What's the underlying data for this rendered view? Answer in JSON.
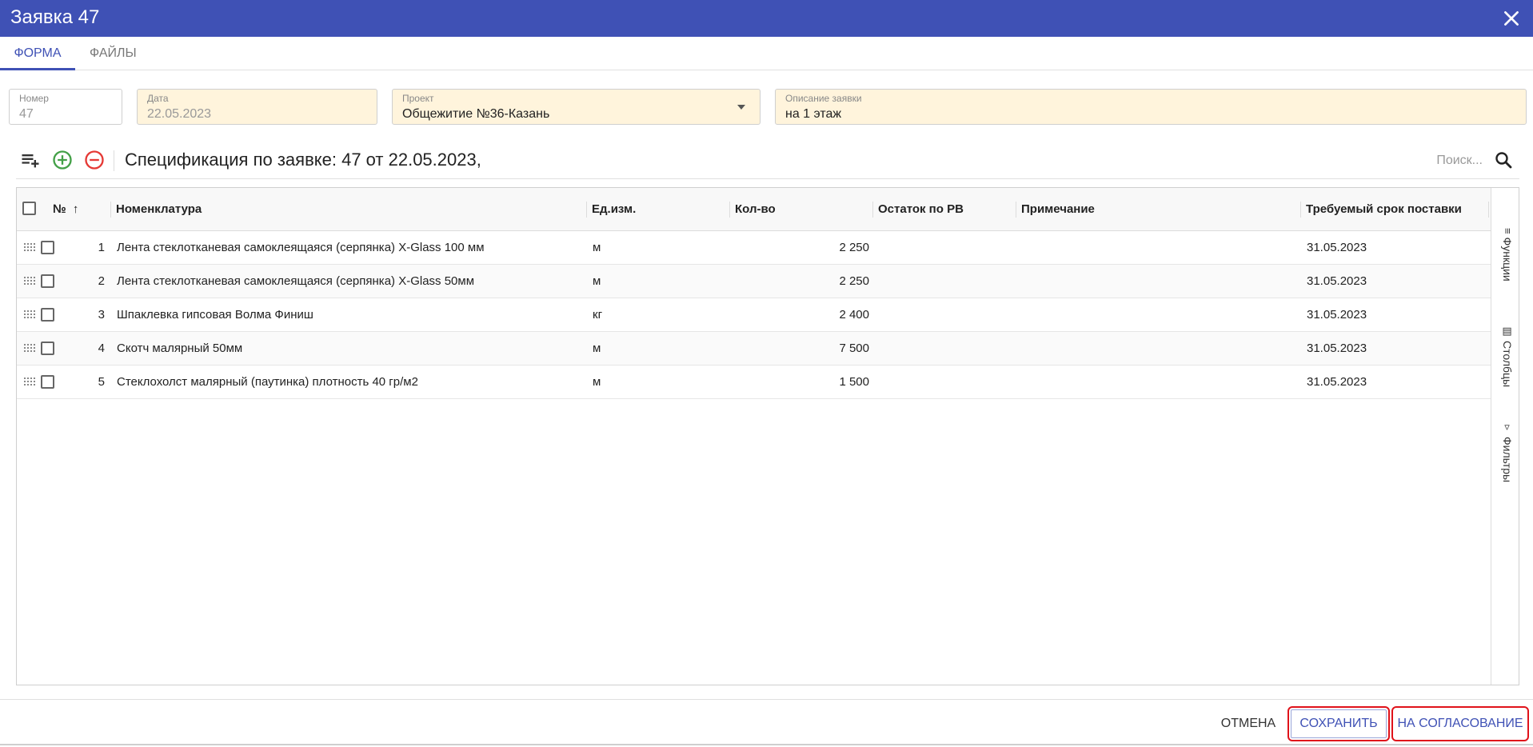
{
  "window": {
    "title": "Заявка 47"
  },
  "tabs": [
    {
      "label": "ФОРМА",
      "active": true
    },
    {
      "label": "ФАЙЛЫ",
      "active": false
    }
  ],
  "fields": {
    "number": {
      "label": "Номер",
      "value": "47"
    },
    "date": {
      "label": "Дата",
      "value": "22.05.2023"
    },
    "project": {
      "label": "Проект",
      "value": "Общежитие №36-Казань"
    },
    "description": {
      "label": "Описание заявки",
      "value": "на 1 этаж"
    }
  },
  "spec": {
    "title": "Спецификация по заявке: 47 от 22.05.2023,",
    "search_placeholder": "Поиск..."
  },
  "grid": {
    "columns": [
      "№",
      "Номенклатура",
      "Ед.изм.",
      "Кол-во",
      "Остаток по РВ",
      "Примечание",
      "Требуемый срок поставки"
    ],
    "rows": [
      {
        "n": "1",
        "name": "Лента стеклотканевая самоклеящаяся (серпянка) X-Glass 100 мм",
        "unit": "м",
        "qty": "2 250",
        "rest": "",
        "note": "",
        "due": "31.05.2023"
      },
      {
        "n": "2",
        "name": "Лента стеклотканевая самоклеящаяся (серпянка) X-Glass 50мм",
        "unit": "м",
        "qty": "2 250",
        "rest": "",
        "note": "",
        "due": "31.05.2023"
      },
      {
        "n": "3",
        "name": "Шпаклевка гипсовая Волма Финиш",
        "unit": "кг",
        "qty": "2 400",
        "rest": "",
        "note": "",
        "due": "31.05.2023"
      },
      {
        "n": "4",
        "name": "Скотч малярный 50мм",
        "unit": "м",
        "qty": "7 500",
        "rest": "",
        "note": "",
        "due": "31.05.2023"
      },
      {
        "n": "5",
        "name": "Стеклохолст малярный (паутинка) плотность 40 гр/м2",
        "unit": "м",
        "qty": "1 500",
        "rest": "",
        "note": "",
        "due": "31.05.2023"
      }
    ],
    "side_panel": [
      "Функции",
      "Столбцы",
      "Фильтры"
    ]
  },
  "footer": {
    "cancel": "ОТМЕНА",
    "save": "СОХРАНИТЬ",
    "approve": "НА СОГЛАСОВАНИЕ"
  },
  "colors": {
    "accent": "#3f51b5",
    "field_yellow": "#fff4dc",
    "add": "#43a047",
    "remove": "#e53935",
    "highlight": "#e0121a"
  }
}
